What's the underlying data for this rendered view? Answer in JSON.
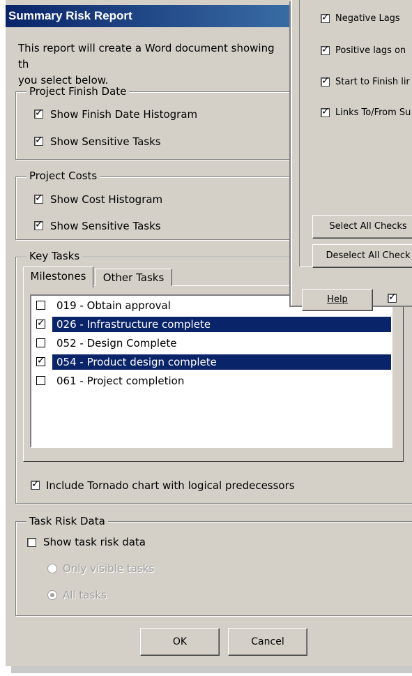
{
  "dialog": {
    "title": "Summary Risk Report",
    "intro": "This report will create a Word document showing th\nyou select below."
  },
  "finish_date": {
    "legend": "Project Finish Date",
    "show_histogram": {
      "label": "Show Finish Date Histogram",
      "checked": true
    },
    "show_sensitive": {
      "label": "Show Sensitive Tasks",
      "checked": true
    }
  },
  "costs": {
    "legend": "Project Costs",
    "show_histogram": {
      "label": "Show Cost Histogram",
      "checked": true
    },
    "show_sensitive": {
      "label": "Show Sensitive Tasks",
      "checked": true
    }
  },
  "key_tasks": {
    "legend": "Key Tasks",
    "tabs": [
      "Milestones",
      "Other Tasks"
    ],
    "items": [
      {
        "label": "019 - Obtain approval",
        "checked": false,
        "selected": false
      },
      {
        "label": "026 - Infrastructure complete",
        "checked": true,
        "selected": true
      },
      {
        "label": "052 - Design Complete",
        "checked": false,
        "selected": false
      },
      {
        "label": "054 - Product design complete",
        "checked": true,
        "selected": true
      },
      {
        "label": "061 - Project completion",
        "checked": false,
        "selected": false
      }
    ],
    "tornado": {
      "label": "Include Tornado chart with logical predecessors",
      "checked": true
    }
  },
  "task_risk": {
    "legend": "Task Risk Data",
    "show": {
      "label": "Show task risk data",
      "checked": false
    },
    "options": [
      {
        "label": "Only visible tasks",
        "selected": false
      },
      {
        "label": "All tasks",
        "selected": true
      }
    ]
  },
  "buttons": {
    "ok": "OK",
    "cancel": "Cancel"
  },
  "background_window": {
    "checks": [
      {
        "label": "Negative Lags",
        "checked": true
      },
      {
        "label": "Positive lags on",
        "checked": true
      },
      {
        "label": "Start to Finish lir",
        "checked": true
      },
      {
        "label": "Links To/From Su",
        "checked": true
      }
    ],
    "select_all": "Select All Checks",
    "deselect_all": "Deselect All Check",
    "help": "Help"
  }
}
